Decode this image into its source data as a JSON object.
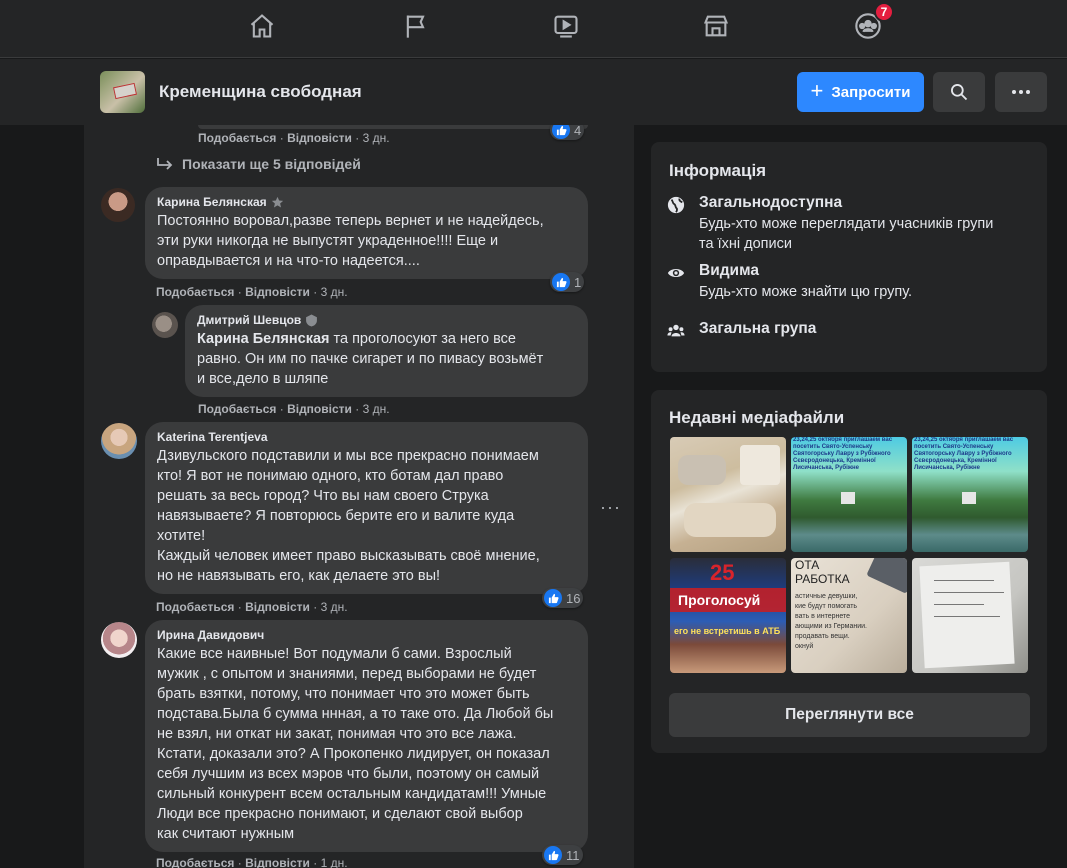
{
  "topnav": {
    "icons": [
      "home-icon",
      "flag-icon",
      "watch-icon",
      "marketplace-icon",
      "groups-icon"
    ],
    "groups_badge": "7"
  },
  "group": {
    "name": "Кременщина свободная",
    "invite_label": "Запросити",
    "search_icon": "search-icon",
    "more_icon": "more-icon"
  },
  "feed": {
    "top_meta": {
      "like": "Подобається",
      "reply": "Відповісти",
      "time": "3 дн.",
      "reactions": "4"
    },
    "more_replies": "Показати ще 5 відповідей",
    "comments": [
      {
        "author": "Карина Белянская",
        "text": "Постоянно воровал,разве теперь вернет и не надейдесь,\nэти руки никогда не выпустят украденное!!!! Еще и\nоправдывается и на что-то надеется....",
        "like": "Подобається",
        "reply": "Відповісти",
        "time": "3 дн.",
        "reactions": "1"
      },
      {
        "author": "Дмитрий Шевцов",
        "mention": "Карина Белянская",
        "text": " та проголосуют за него все\nравно. Он им по пачке сигарет и по пивасу возьмёт\nи все,дело в шляпе",
        "like": "Подобається",
        "reply": "Відповісти",
        "time": "3 дн."
      },
      {
        "author": "Katerina Terentjeva",
        "text": "Дзивульского подставили и мы все прекрасно понимаем\nкто! Я вот не понимаю одного, кто ботам дал право\nрешать за весь город? Что вы нам своего Струка\nнавязываете? Я повторюсь берите его и валите куда\nхотите!\nКаждый человек имеет право высказывать своё мнение,\nно не навязывать его, как делаете это вы!",
        "like": "Подобається",
        "reply": "Відповісти",
        "time": "3 дн.",
        "reactions": "16"
      },
      {
        "author": "Ирина Давидович",
        "text": "Какие все наивные! Вот подумали б сами. Взрослый\nмужик , с опытом и знаниями, перед выборами не будет\nбрать взятки, потому, что понимает что это может быть\nподстава.Была б сумма ннная, а то таке ото. Да Любой бы\nне взял, ни откат ни закат, понимая что это все лажа.\nКстати, доказали это? А Прокопенко лидирует, он показал\nсебя лучшим из всех мэров что были, поэтому он самый\nсильный конкурент всем остальным кандидатам!!! Умные\nЛюди все прекрасно понимают, и сделают свой выбор\nкак считают нужным",
        "like": "Подобається",
        "reply": "Відповісти",
        "time": "1 дн.",
        "reactions": "11"
      }
    ]
  },
  "info": {
    "title": "Інформація",
    "rows": [
      {
        "icon": "globe-icon",
        "title": "Загальнодоступна",
        "desc": "Будь-хто може переглядати учасників групи\nта їхні дописи"
      },
      {
        "icon": "eye-icon",
        "title": "Видима",
        "desc": "Будь-хто може знайти цю групу."
      },
      {
        "icon": "people-icon",
        "title": "Загальна група",
        "desc": ""
      }
    ]
  },
  "media": {
    "title": "Недавні медіафайли",
    "tile_texts": {
      "t2": "23,24,25 октября приглашаем вас посетить Свято-Успенську Святогорську Лавру з Рубіжного Сєвєродонецька, Кремінної Лисичанська, Рубіжне",
      "t3": "23,24,25 октября приглашаем вас посетить Свято-Успенську Святогорську Лавру з Рубіжного Сєвєродонецька, Кремінної Лисичанська, Рубіжне",
      "t4a": "Проголосуй",
      "t4b": "его не встретишь в АТБ",
      "t5a": "ОТА",
      "t5b": "РАБОТКА",
      "t5c": "астичные девушки,\nкие будут помогать\nвать в интернете\nающими из Германии.\nпродавать вещи.\nокнуй"
    },
    "view_all": "Переглянути все"
  },
  "colors": {
    "accent": "#2d88ff",
    "like": "#1877f2",
    "badge": "#e41e3f",
    "bg": "#18191a",
    "card": "#242526",
    "bubble": "#3a3b3c"
  }
}
